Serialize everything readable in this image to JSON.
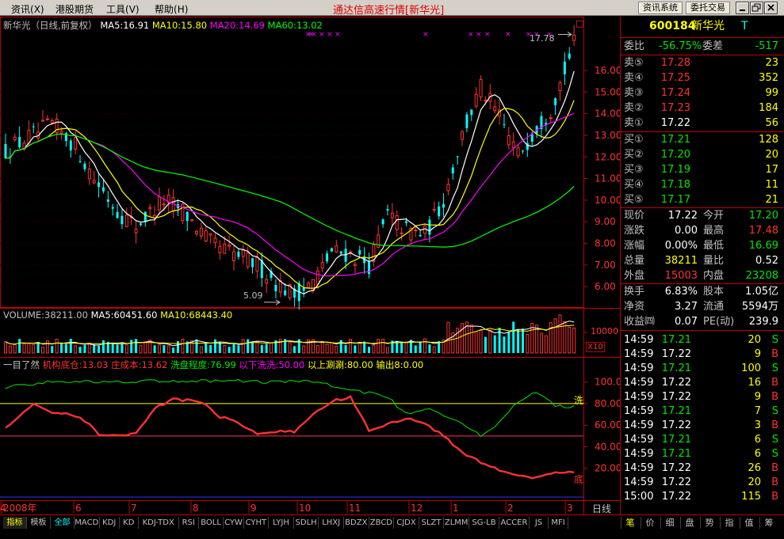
{
  "menu": {
    "items": [
      "资讯",
      "港股期货",
      "工具",
      "帮助"
    ],
    "shortcuts": [
      "(X)",
      "",
      "(V)",
      "(H)"
    ]
  },
  "window": {
    "title": "通达信高速行情",
    "bracket": "[新华光]",
    "btn_info": "资讯系统",
    "btn_trade": "委托交易"
  },
  "chart": {
    "legend_main": [
      "新华光（日线,前复权）",
      "MA5:16.91",
      "MA10:15.80",
      "MA20:14.69",
      "MA60:13.02"
    ],
    "legend_volume": [
      "VOLUME:38211.00",
      "MA5:60451.60",
      "MA10:68443.40"
    ],
    "legend_indicator": [
      "一目了然",
      "机构底仓:13.03",
      "庄成本:13.62",
      "洗盘程度:76.99",
      "以下洗洗:50.00",
      "以上涮涮:80.00",
      "输出8:0.00"
    ],
    "price_ticks": [
      "16.00",
      "15.00",
      "14.00",
      "13.00",
      "12.00",
      "11.00",
      "10.00",
      "9.00",
      "8.00",
      "7.00",
      "6.00"
    ],
    "price_tick_values": [
      16,
      15,
      14,
      13,
      12,
      11,
      10,
      9,
      8,
      7,
      6
    ],
    "volume_tick": "10000",
    "volume_mult": "X10",
    "ind_ticks": [
      "100.0",
      "80.00",
      "60.00",
      "40.00",
      "20.00"
    ],
    "ind_tick_values": [
      100,
      80,
      60,
      40,
      20
    ],
    "high_label": "17.78",
    "low_label": "5.09",
    "ind_label_wash": "洗",
    "ind_label_bottom": "底",
    "dates": [
      "2008年",
      "6",
      "7",
      "8",
      "9",
      "10",
      "11",
      "12",
      "1",
      "2",
      "3",
      "4"
    ],
    "period": "日线",
    "corner": "□"
  },
  "chart_data": {
    "type": "candlestick",
    "title": "新华光（日线,前复权）",
    "ylim": [
      5,
      18.2
    ],
    "price_high": 17.78,
    "price_low": 5.09,
    "ma_values": {
      "MA5": 16.91,
      "MA10": 15.8,
      "MA20": 14.69,
      "MA60": 13.02
    },
    "volume_values": {
      "VOLUME": 38211.0,
      "MA5": 60451.6,
      "MA10": 68443.4
    },
    "indicator_values": {
      "机构底仓": 13.03,
      "庄成本": 13.62,
      "洗盘程度": 76.99,
      "以下洗洗": 50.0,
      "以上涮涮": 80.0,
      "输出8": 0.0
    },
    "indicator_ylim": [
      0,
      110
    ],
    "price_path": [
      [
        0,
        12.3
      ],
      [
        10,
        13.5
      ],
      [
        15,
        12.5
      ],
      [
        19,
        11.0
      ],
      [
        24,
        9.5
      ],
      [
        28,
        8.8
      ],
      [
        34,
        10.0
      ],
      [
        38,
        9.5
      ],
      [
        44,
        8.0
      ],
      [
        48,
        7.6
      ],
      [
        54,
        7.0
      ],
      [
        58,
        6.2
      ],
      [
        62,
        5.6
      ],
      [
        66,
        6.2
      ],
      [
        70,
        7.6
      ],
      [
        74,
        7.5
      ],
      [
        78,
        7.0
      ],
      [
        82,
        9.3
      ],
      [
        86,
        8.6
      ],
      [
        90,
        8.4
      ],
      [
        94,
        10.0
      ],
      [
        98,
        13.0
      ],
      [
        102,
        15.2
      ],
      [
        106,
        13.8
      ],
      [
        110,
        12.1
      ],
      [
        114,
        13.4
      ],
      [
        117,
        14.2
      ],
      [
        122,
        17.2
      ]
    ],
    "wash_path": [
      [
        0,
        95
      ],
      [
        10,
        101
      ],
      [
        20,
        100
      ],
      [
        30,
        101
      ],
      [
        40,
        101
      ],
      [
        50,
        101
      ],
      [
        58,
        100
      ],
      [
        66,
        101
      ],
      [
        72,
        94
      ],
      [
        78,
        90
      ],
      [
        82,
        86
      ],
      [
        86,
        70
      ],
      [
        90,
        76
      ],
      [
        94,
        70
      ],
      [
        98,
        62
      ],
      [
        102,
        50
      ],
      [
        106,
        62
      ],
      [
        110,
        82
      ],
      [
        114,
        91
      ],
      [
        118,
        78
      ],
      [
        122,
        77
      ]
    ],
    "cost_path": [
      [
        0,
        58
      ],
      [
        6,
        80
      ],
      [
        10,
        72
      ],
      [
        16,
        68
      ],
      [
        20,
        52
      ],
      [
        24,
        50
      ],
      [
        28,
        52
      ],
      [
        32,
        76
      ],
      [
        36,
        84
      ],
      [
        42,
        82
      ],
      [
        46,
        68
      ],
      [
        50,
        62
      ],
      [
        54,
        52
      ],
      [
        58,
        54
      ],
      [
        62,
        54
      ],
      [
        66,
        70
      ],
      [
        70,
        82
      ],
      [
        74,
        86
      ],
      [
        78,
        55
      ],
      [
        82,
        61
      ],
      [
        86,
        66
      ],
      [
        90,
        62
      ],
      [
        94,
        50
      ],
      [
        98,
        35
      ],
      [
        102,
        25
      ],
      [
        106,
        19
      ],
      [
        110,
        14
      ],
      [
        114,
        11
      ],
      [
        118,
        16
      ],
      [
        122,
        17
      ]
    ]
  },
  "stock": {
    "code": "600184",
    "name": "新华光",
    "tag": "T",
    "wb_label": "委比",
    "wb": "-56.75%",
    "wc_label": "委差",
    "wc": "-517"
  },
  "sells": [
    {
      "label": "卖⑤",
      "price": "17.28",
      "vol": "23"
    },
    {
      "label": "卖④",
      "price": "17.25",
      "vol": "352"
    },
    {
      "label": "卖③",
      "price": "17.24",
      "vol": "99"
    },
    {
      "label": "卖②",
      "price": "17.23",
      "vol": "184"
    },
    {
      "label": "卖①",
      "price": "17.22",
      "vol": "56"
    }
  ],
  "buys": [
    {
      "label": "买①",
      "price": "17.21",
      "vol": "128"
    },
    {
      "label": "买②",
      "price": "17.20",
      "vol": "20"
    },
    {
      "label": "买③",
      "price": "17.19",
      "vol": "17"
    },
    {
      "label": "买④",
      "price": "17.18",
      "vol": "11"
    },
    {
      "label": "买⑤",
      "price": "17.17",
      "vol": "21"
    }
  ],
  "quote": [
    {
      "l1": "现价",
      "v1": "17.22",
      "l2": "今开",
      "v2": "17.20"
    },
    {
      "l1": "涨跌",
      "v1": "0.00",
      "l2": "最高",
      "v2": "17.48"
    },
    {
      "l1": "涨幅",
      "v1": "0.00%",
      "l2": "最低",
      "v2": "16.69"
    },
    {
      "l1": "总量",
      "v1": "38211",
      "l2": "量比",
      "v2": "0.52"
    },
    {
      "l1": "外盘",
      "v1": "15003",
      "l2": "内盘",
      "v2": "23208"
    }
  ],
  "fin": [
    {
      "l1": "换手",
      "v1": "6.83%",
      "l2": "股本",
      "v2": "1.05亿"
    },
    {
      "l1": "净资",
      "v1": "3.27",
      "l2": "流通",
      "v2": "5594万"
    },
    {
      "l1": "收益㈣",
      "v1": "0.07",
      "l2": "PE(动)",
      "v2": "239.9"
    }
  ],
  "ticks": [
    {
      "t": "14:59",
      "p": "17.21",
      "v": "20",
      "d": "S"
    },
    {
      "t": "14:59",
      "p": "17.22",
      "v": "9",
      "d": "B"
    },
    {
      "t": "14:59",
      "p": "17.21",
      "v": "100",
      "d": "S"
    },
    {
      "t": "14:59",
      "p": "17.22",
      "v": "16",
      "d": "B"
    },
    {
      "t": "14:59",
      "p": "17.22",
      "v": "9",
      "d": "B"
    },
    {
      "t": "14:59",
      "p": "17.21",
      "v": "7",
      "d": "S"
    },
    {
      "t": "14:59",
      "p": "17.22",
      "v": "3",
      "d": "B"
    },
    {
      "t": "14:59",
      "p": "17.21",
      "v": "6",
      "d": "S"
    },
    {
      "t": "14:59",
      "p": "17.21",
      "v": "6",
      "d": "S"
    },
    {
      "t": "14:59",
      "p": "17.22",
      "v": "26",
      "d": "B"
    },
    {
      "t": "14:59",
      "p": "17.22",
      "v": "20",
      "d": "B"
    },
    {
      "t": "15:00",
      "p": "17.22",
      "v": "115",
      "d": "B"
    }
  ],
  "bottom_tabs": [
    "指标",
    "模板",
    "全部",
    "MACD",
    "KDJ",
    "KD",
    "KDJ-TDX",
    "RSI",
    "BOLL",
    "CYW",
    "CYHT",
    "LYJH",
    "SDLH",
    "LHXJ",
    "BDZX",
    "ZBCD",
    "CJDX",
    "SLZT",
    "ZLMM",
    "SG-LB",
    "ACCER",
    "JS",
    "MFI"
  ],
  "right_tabs": [
    "笔",
    "价",
    "细",
    "盘",
    "势",
    "指",
    "值",
    "筹"
  ],
  "colors": {
    "red": "#ff3232",
    "green": "#00e600",
    "yellow": "#ffff00",
    "white": "#ffffff",
    "magenta": "#ff00ff",
    "cyan": "#00ffff",
    "ma5": "#ffffff",
    "ma10": "#ffff00",
    "ma20": "#ff00ff",
    "ma60": "#00ff00"
  }
}
